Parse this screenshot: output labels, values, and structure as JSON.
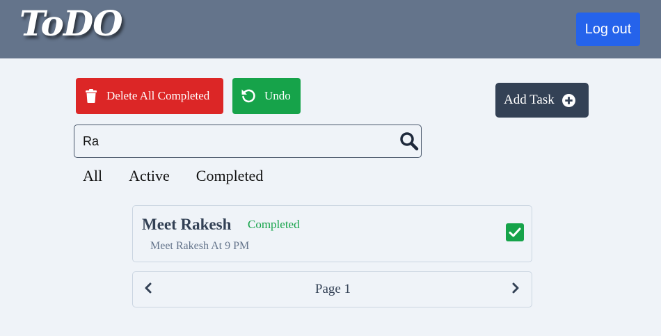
{
  "app": {
    "logo_text": "ToDO"
  },
  "header": {
    "logout_label": "Log out"
  },
  "toolbar": {
    "delete_completed_label": "Delete All Completed",
    "undo_label": "Undo",
    "add_task_label": "Add Task"
  },
  "search": {
    "value": "Ra",
    "placeholder": ""
  },
  "filters": {
    "all": "All",
    "active": "Active",
    "completed": "Completed"
  },
  "tasks": [
    {
      "title": "Meet Rakesh",
      "status": "Completed",
      "description": "Meet Rakesh At 9 PM",
      "checked": true
    }
  ],
  "pagination": {
    "label": "Page 1"
  },
  "colors": {
    "navbar": "#64748b",
    "logout": "#2563eb",
    "delete": "#dc2626",
    "undo": "#16a34a",
    "add": "#334155",
    "completed_status": "#16a34a",
    "background": "#eff3f8"
  },
  "icons": {
    "delete": "trash-icon",
    "undo": "undo-icon",
    "add": "plus-circle-icon",
    "search": "search-icon",
    "check": "checkbox-checked-icon",
    "prev": "chevron-left-icon",
    "next": "chevron-right-icon"
  }
}
